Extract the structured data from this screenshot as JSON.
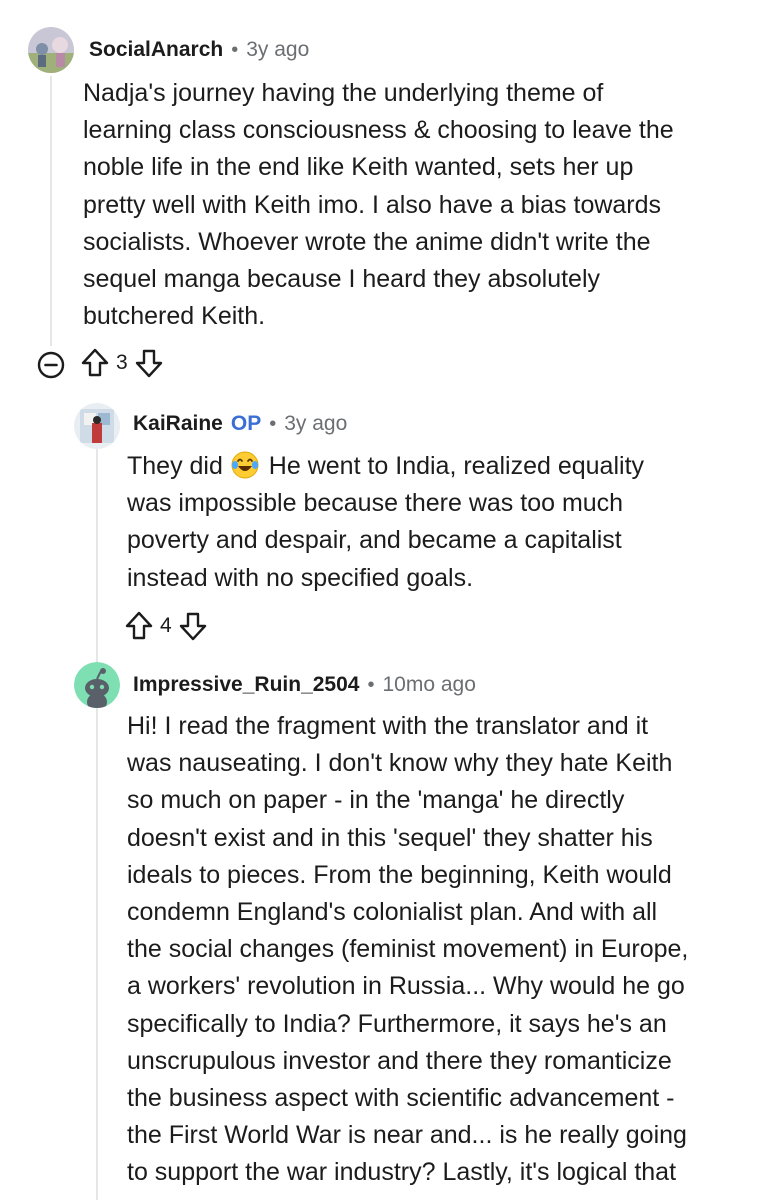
{
  "comments": [
    {
      "author": "SocialAnarch",
      "time": "3y ago",
      "lines": [
        "Nadja's journey having the underlying theme of",
        "learning class consciousness & choosing to leave the",
        "noble life in the end like Keith wanted, sets her up",
        "pretty well with Keith imo. I also have a bias towards",
        "socialists. Whoever wrote the anime didn't write the",
        "sequel manga because I heard they absolutely",
        "butchered Keith."
      ],
      "votes": "3"
    },
    {
      "author": "KaiRaine",
      "badge": "OP",
      "time": "3y ago",
      "first_line_start": "They did",
      "first_line_end": "He went to India, realized equality",
      "lines": [
        "was impossible because there was too much",
        "poverty and despair, and became a capitalist",
        "instead with no specified goals."
      ],
      "votes": "4"
    },
    {
      "author": "Impressive_Ruin_2504",
      "time": "10mo ago",
      "lines": [
        "Hi! I read the fragment with the translator and it",
        "was nauseating. I don't know why they hate Keith",
        "so much on paper - in the 'manga' he directly",
        "doesn't exist and in this 'sequel' they shatter his",
        "ideals to pieces. From the beginning, Keith would",
        "condemn England's colonialist plan. And with all",
        "the social changes (feminist movement) in Europe,",
        "a workers' revolution in Russia... Why would he go",
        "specifically to India? Furthermore, it says he's an",
        "unscrupulous investor and there they romanticize",
        "the business aspect with scientific advancement -",
        "the First World War is near and... is he really going",
        "to support the war industry? Lastly, it's logical that"
      ]
    }
  ],
  "separator": "•",
  "colors": {
    "text": "#1c1c1c",
    "meta": "#6b6f72",
    "op": "#3b6fd6",
    "thread_line": "#e4e6e8"
  }
}
